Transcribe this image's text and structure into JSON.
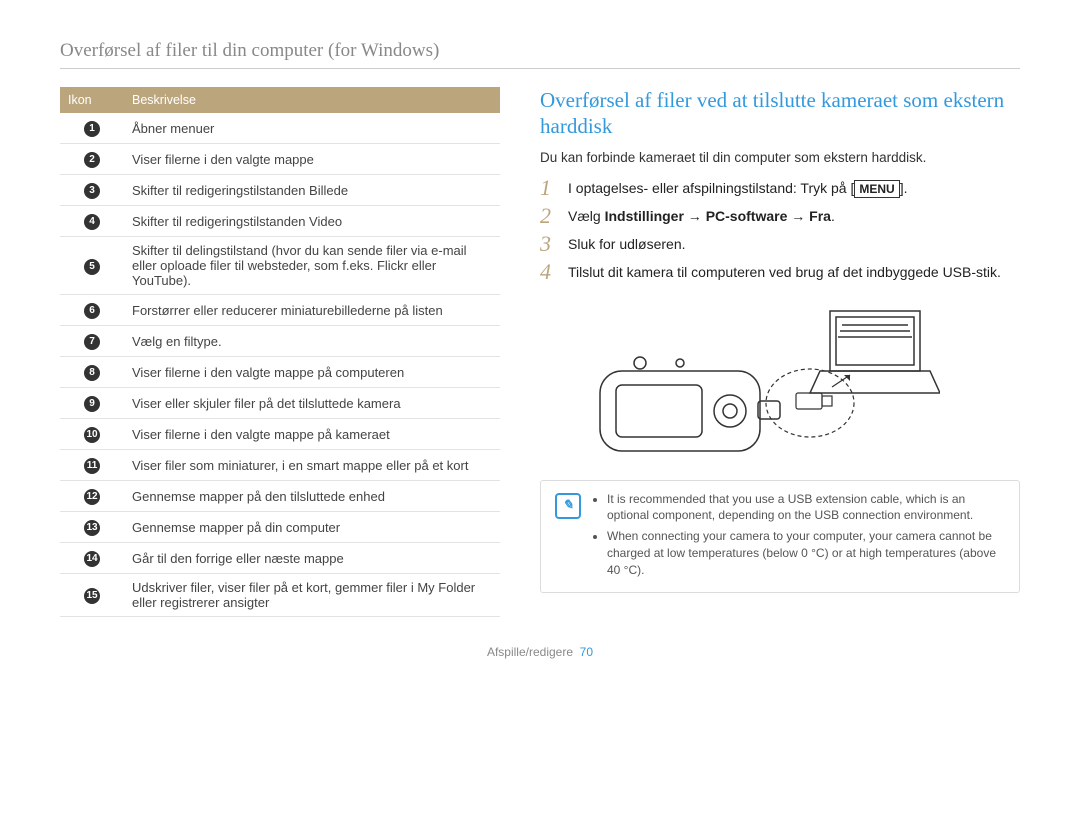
{
  "page_title": "Overførsel af filer til din computer (for Windows)",
  "table": {
    "headers": {
      "icon": "Ikon",
      "desc": "Beskrivelse"
    },
    "rows": [
      {
        "n": "1",
        "desc": "Åbner menuer"
      },
      {
        "n": "2",
        "desc": "Viser filerne i den valgte mappe"
      },
      {
        "n": "3",
        "desc": "Skifter til redigeringstilstanden Billede"
      },
      {
        "n": "4",
        "desc": "Skifter til redigeringstilstanden Video"
      },
      {
        "n": "5",
        "desc": "Skifter til delingstilstand (hvor du kan sende filer via e-mail eller oploade filer til websteder, som f.eks. Flickr eller YouTube)."
      },
      {
        "n": "6",
        "desc": "Forstørrer eller reducerer miniaturebillederne på listen"
      },
      {
        "n": "7",
        "desc": "Vælg en filtype."
      },
      {
        "n": "8",
        "desc": "Viser filerne i den valgte mappe på computeren"
      },
      {
        "n": "9",
        "desc": "Viser eller skjuler filer på det tilsluttede kamera"
      },
      {
        "n": "10",
        "desc": "Viser filerne i den valgte mappe på kameraet"
      },
      {
        "n": "11",
        "desc": "Viser filer som miniaturer, i en smart mappe eller på et kort"
      },
      {
        "n": "12",
        "desc": "Gennemse mapper på den tilsluttede enhed"
      },
      {
        "n": "13",
        "desc": "Gennemse mapper på din computer"
      },
      {
        "n": "14",
        "desc": "Går til den forrige eller næste mappe"
      },
      {
        "n": "15",
        "desc": "Udskriver filer, viser filer på et kort, gemmer filer i My Folder eller registrerer ansigter"
      }
    ]
  },
  "right": {
    "heading": "Overførsel af filer ved at tilslutte kameraet som ekstern harddisk",
    "intro": "Du kan forbinde kameraet til din computer som ekstern harddisk.",
    "steps": [
      {
        "n": "1",
        "pre": "I optagelses- eller afspilningstilstand: Tryk på [",
        "key": "MENU",
        "post": "]."
      },
      {
        "n": "2",
        "pre": "Vælg ",
        "bold": "Indstillinger → PC-software → Fra",
        "post": "."
      },
      {
        "n": "3",
        "text": "Sluk for udløseren."
      },
      {
        "n": "4",
        "text": "Tilslut dit kamera til computeren ved brug af det indbyggede USB-stik."
      }
    ],
    "notes": [
      "It is recommended that you use a USB extension cable, which is an optional component, depending on the USB connection environment.",
      "When connecting your camera to your computer, your camera cannot be charged at low temperatures (below 0 °C) or at high temperatures (above 40 °C)."
    ]
  },
  "footer": {
    "section": "Afspille/redigere",
    "page": "70"
  }
}
